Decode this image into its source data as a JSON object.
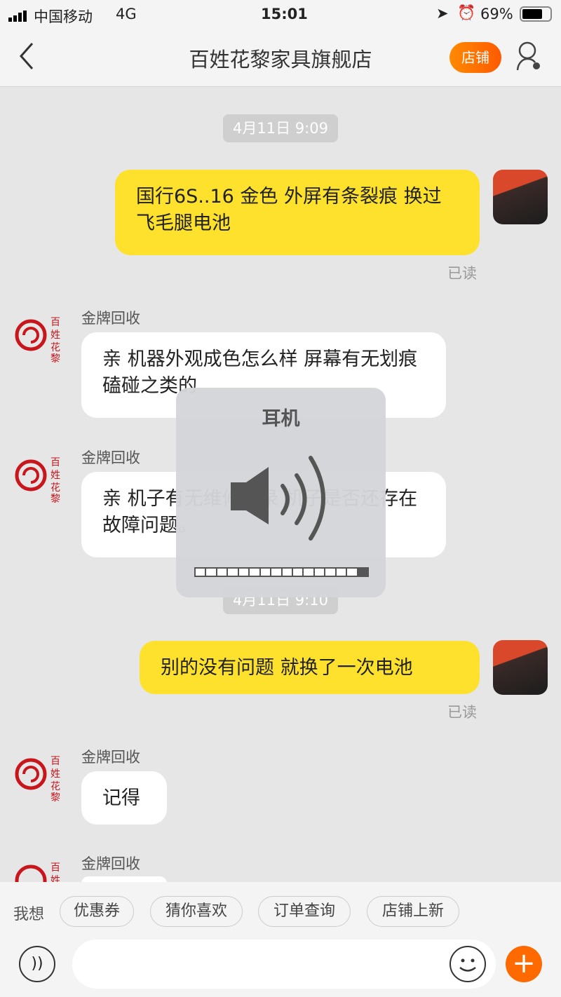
{
  "status": {
    "carrier": "中国移动",
    "network": "4G",
    "time": "15:01",
    "battery": "69%",
    "battery_level": 0.69
  },
  "header": {
    "back": "back",
    "title": "百姓花黎家具旗舰店",
    "shop_button": "店铺"
  },
  "messages": [
    {
      "type": "time",
      "text": "4月11日 9:09"
    },
    {
      "type": "me",
      "text": "国行6S..16  金色  外屏有条裂痕 换过飞毛腿电池",
      "status": "已读"
    },
    {
      "type": "them",
      "sender": "金牌回收",
      "text": "亲 机器外观成色怎么样 屏幕有无划痕磕碰之类的"
    },
    {
      "type": "them",
      "sender": "金牌回收",
      "text": "亲   机子有无维修记录  机子是否还存在故障问题。"
    },
    {
      "type": "time",
      "text": "4月11日 9:10"
    },
    {
      "type": "me",
      "text": "别的没有问题  就换了一次电池",
      "status": "已读"
    },
    {
      "type": "them",
      "sender": "金牌回收",
      "text": "记得"
    },
    {
      "type": "them",
      "sender": "金牌回收",
      "text": ""
    }
  ],
  "logo_text": "百姓花黎",
  "volume_hud": {
    "label": "耳机",
    "level": 0.9375,
    "segments": 16
  },
  "quick_replies": {
    "label": "我想",
    "items": [
      "优惠券",
      "猜你喜欢",
      "订单查询",
      "店铺上新"
    ]
  },
  "colors": {
    "accent": "#ff6a00",
    "my_bubble": "#fde12d"
  }
}
